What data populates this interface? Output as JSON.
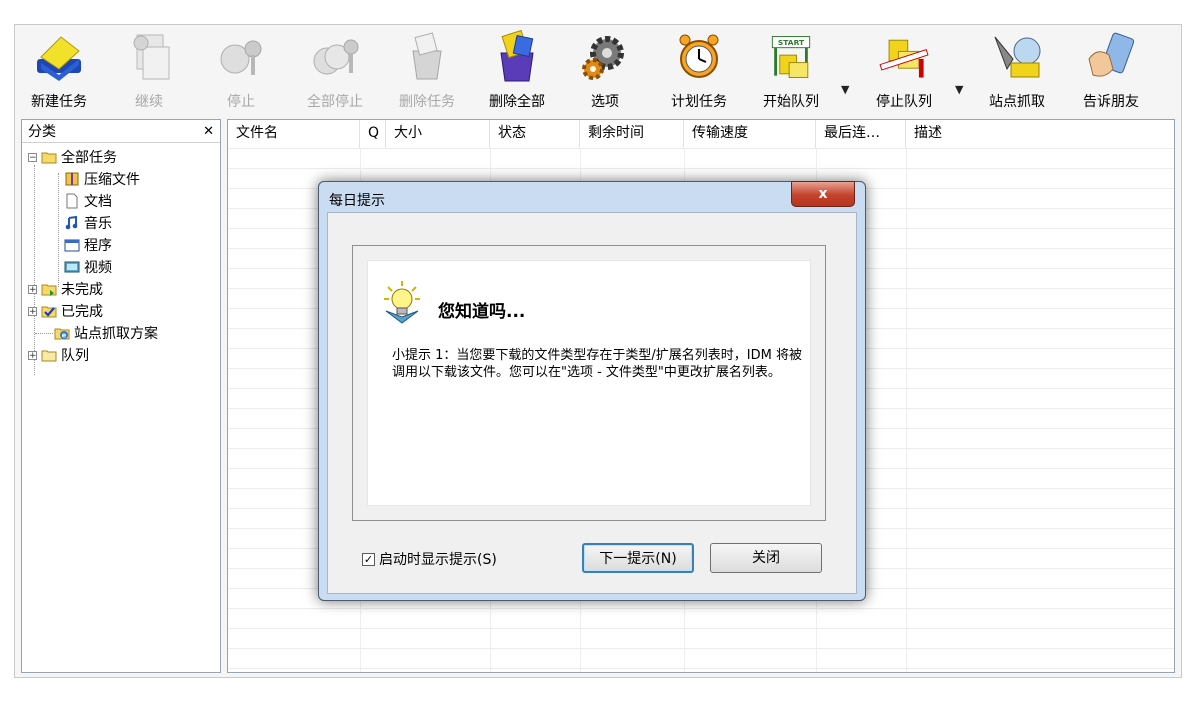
{
  "toolbar": {
    "items": [
      {
        "label": "新建任务",
        "icon": "new-task-icon",
        "enabled": true
      },
      {
        "label": "继续",
        "icon": "resume-icon",
        "enabled": false
      },
      {
        "label": "停止",
        "icon": "stop-icon",
        "enabled": false
      },
      {
        "label": "全部停止",
        "icon": "stop-all-icon",
        "enabled": false
      },
      {
        "label": "删除任务",
        "icon": "delete-task-icon",
        "enabled": false
      },
      {
        "label": "删除全部",
        "icon": "delete-all-icon",
        "enabled": true
      },
      {
        "label": "选项",
        "icon": "options-gear-icon",
        "enabled": true
      },
      {
        "label": "计划任务",
        "icon": "alarm-clock-icon",
        "enabled": true
      },
      {
        "label": "开始队列",
        "icon": "start-queue-icon",
        "enabled": true
      },
      {
        "label": "停止队列",
        "icon": "stop-queue-icon",
        "enabled": true
      },
      {
        "label": "站点抓取",
        "icon": "site-grabber-icon",
        "enabled": true
      },
      {
        "label": "告诉朋友",
        "icon": "tell-friend-icon",
        "enabled": true
      }
    ],
    "start_sign": "START"
  },
  "sidebar": {
    "title": "分类",
    "close": "✕",
    "tree": [
      {
        "label": "全部任务",
        "icon": "folder-open-icon"
      },
      {
        "label": "压缩文件",
        "icon": "archive-icon"
      },
      {
        "label": "文档",
        "icon": "document-icon"
      },
      {
        "label": "音乐",
        "icon": "music-note-icon"
      },
      {
        "label": "程序",
        "icon": "program-window-icon"
      },
      {
        "label": "视频",
        "icon": "video-icon"
      },
      {
        "label": "未完成",
        "icon": "unfinished-folder-icon"
      },
      {
        "label": "已完成",
        "icon": "finished-folder-icon"
      },
      {
        "label": "站点抓取方案",
        "icon": "ie-globe-icon"
      },
      {
        "label": "队列",
        "icon": "queue-folder-icon"
      }
    ]
  },
  "list": {
    "columns": [
      "文件名",
      "Q",
      "大小",
      "状态",
      "剩余时间",
      "传输速度",
      "最后连…",
      "描述"
    ]
  },
  "dialog": {
    "title": "每日提示",
    "close": "x",
    "heading": "您知道吗...",
    "tip": "小提示 1：当您要下载的文件类型存在于类型/扩展名列表时，IDM 将被调用以下载该文件。您可以在\"选项 - 文件类型\"中更改扩展名列表。",
    "checkbox_label": "启动时显示提示(S)",
    "checkbox_checked": true,
    "checkbox_mark": "✓",
    "next_button": "下一提示(N)",
    "close_button": "关闭"
  },
  "colors": {
    "dialog_frame": "#c9dcf2",
    "close_red": "#c4432b",
    "default_button_border": "#3c7fb1"
  }
}
